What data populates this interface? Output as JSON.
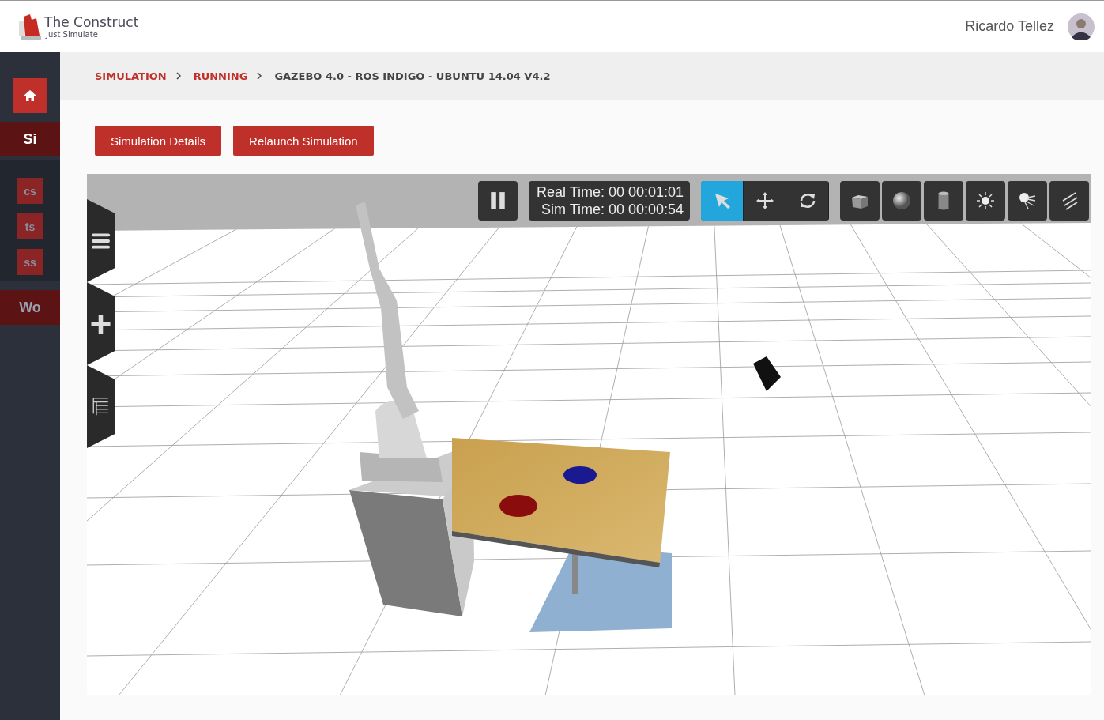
{
  "header": {
    "logo_title": "The Construct",
    "logo_subtitle": "Just Simulate",
    "user_name": "Ricardo Tellez"
  },
  "sidebar": {
    "items": [
      {
        "kind": "home"
      },
      {
        "kind": "main",
        "label": "Si"
      },
      {
        "kind": "sub",
        "label": "cs"
      },
      {
        "kind": "sub",
        "label": "ts"
      },
      {
        "kind": "sub",
        "label": "ss"
      },
      {
        "kind": "main",
        "label": "Wo"
      }
    ]
  },
  "breadcrumb": [
    {
      "label": "SIMULATION",
      "kind": "link"
    },
    {
      "label": "RUNNING",
      "kind": "link"
    },
    {
      "label": "GAZEBO 4.0 - ROS INDIGO - UBUNTU 14.04 V4.2",
      "kind": "current"
    }
  ],
  "buttons": [
    "Simulation Details",
    "Relaunch Simulation"
  ],
  "viewer": {
    "real_time": "Real Time: 00 00:01:01",
    "sim_time": "Sim Time: 00 00:00:54",
    "modes": [
      {
        "kind": "select",
        "selected": true
      },
      {
        "kind": "translate",
        "selected": false
      },
      {
        "kind": "rotate",
        "selected": false
      }
    ],
    "insert_tools": [
      {
        "kind": "box"
      },
      {
        "kind": "sphere"
      },
      {
        "kind": "cylinder"
      },
      {
        "kind": "point"
      },
      {
        "kind": "spot"
      },
      {
        "kind": "directional"
      }
    ],
    "side_tabs": [
      {
        "kind": "menu"
      },
      {
        "kind": "insert"
      },
      {
        "kind": "tree"
      }
    ]
  }
}
